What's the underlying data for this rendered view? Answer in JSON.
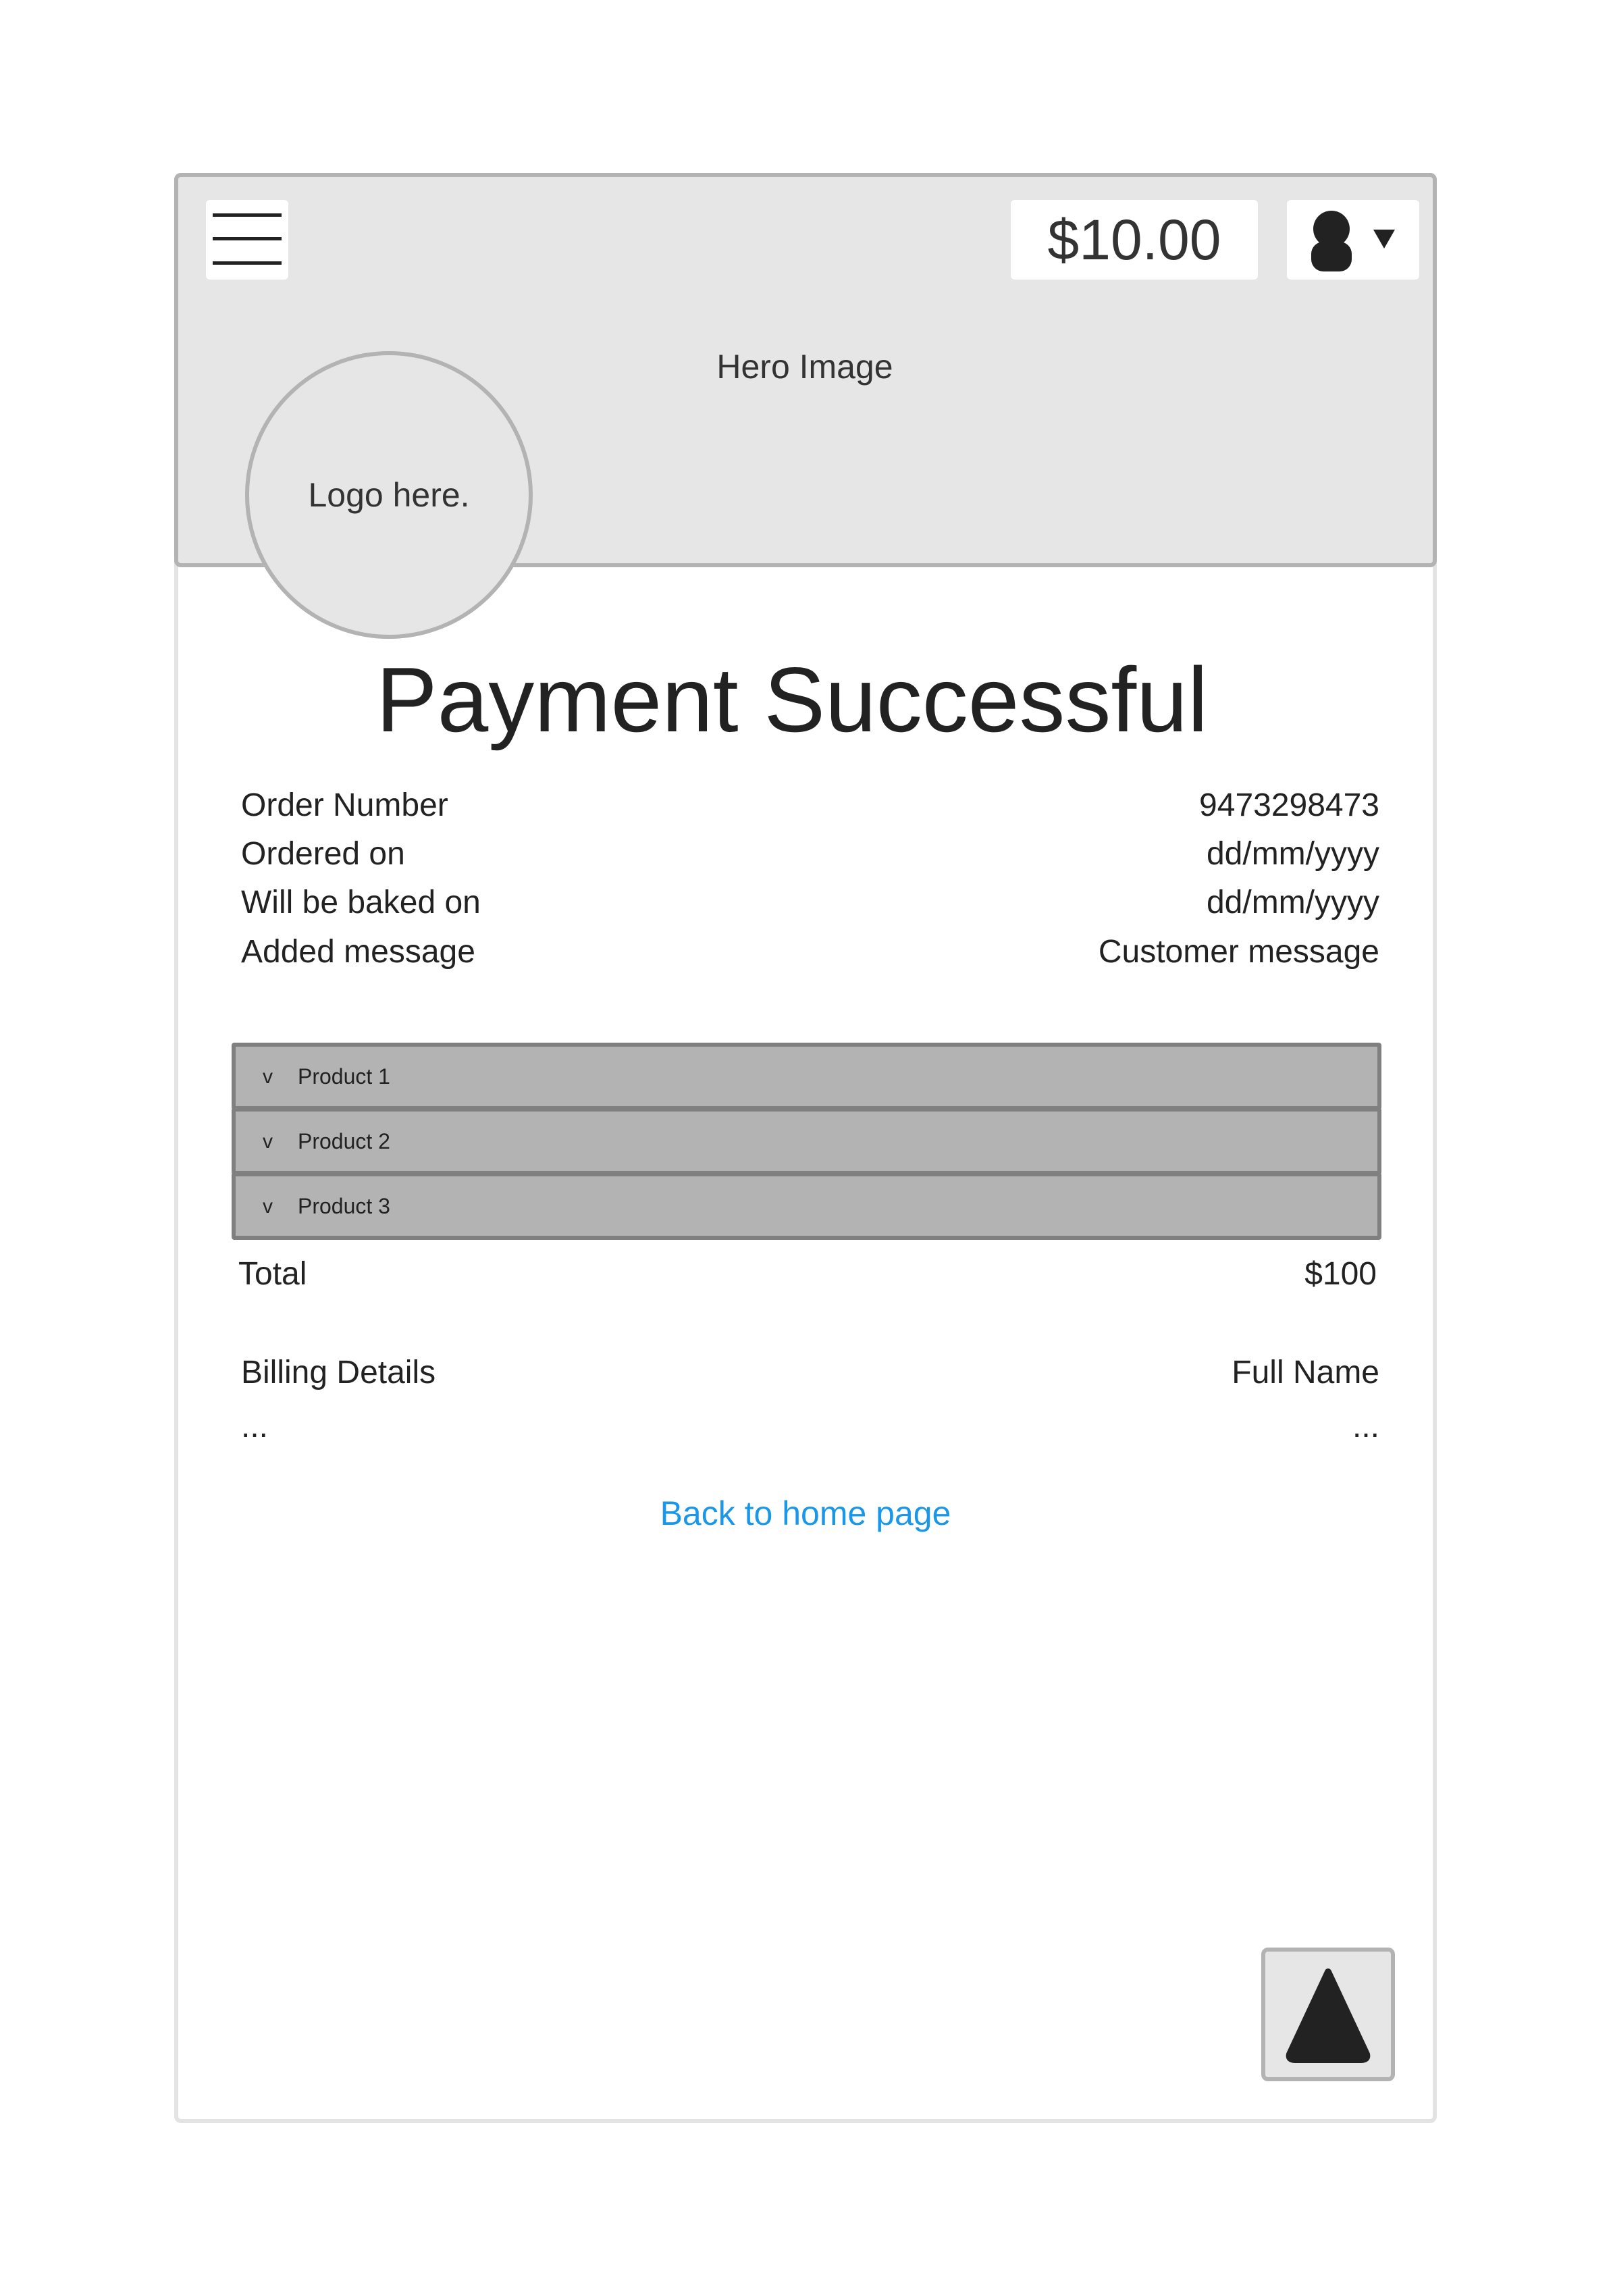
{
  "header": {
    "balance": "$10.00",
    "hero_label": "Hero Image",
    "logo_text": "Logo here."
  },
  "page": {
    "title": "Payment Successful"
  },
  "order_details": [
    {
      "label": "Order Number",
      "value": "9473298473"
    },
    {
      "label": "Ordered on",
      "value": "dd/mm/yyyy"
    },
    {
      "label": "Will be baked on",
      "value": "dd/mm/yyyy"
    },
    {
      "label": "Added message",
      "value": "Customer message"
    }
  ],
  "products": [
    {
      "chevron": "v",
      "name": "Product 1"
    },
    {
      "chevron": "v",
      "name": "Product 2"
    },
    {
      "chevron": "v",
      "name": "Product 3"
    }
  ],
  "total": {
    "label": "Total",
    "value": "$100"
  },
  "billing": {
    "label": "Billing Details",
    "value": "Full Name",
    "left_more": "...",
    "right_more": "..."
  },
  "actions": {
    "back_home": "Back to home page"
  },
  "icons": {
    "menu": "hamburger-menu-icon",
    "user": "user-icon",
    "dropdown": "caret-down-icon",
    "scroll_top": "triangle-up-icon"
  },
  "colors": {
    "header_bg": "#e6e6e6",
    "border": "#b3b3b3",
    "product_bg": "#b3b3b3",
    "product_border": "#808080",
    "link": "#1a97e8",
    "text": "#222222"
  }
}
